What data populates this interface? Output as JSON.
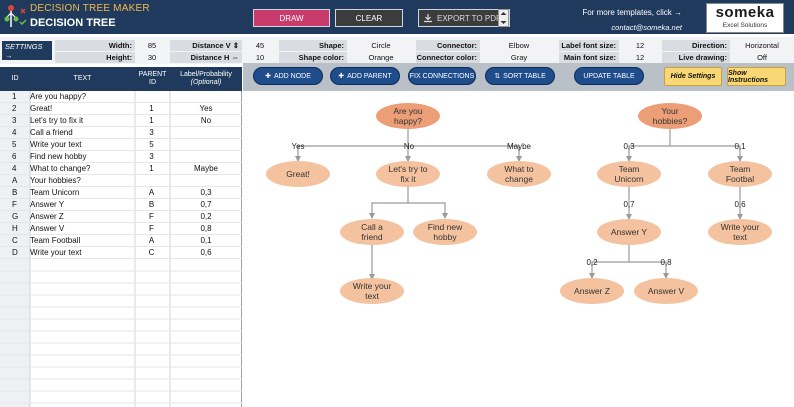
{
  "header": {
    "app_title": "DECISION TREE MAKER",
    "doc_title": "DECISION TREE",
    "draw_label": "DRAW",
    "clear_label": "CLEAR",
    "export_label": "EXPORT TO PDF",
    "templates_text": "For more templates, click →",
    "contact": "contact@someka.net",
    "brand_name": "someka",
    "brand_sub": "Excel Solutions"
  },
  "settings": {
    "label": "SETTINGS →",
    "width_label": "Width:",
    "width": "85",
    "height_label": "Height:",
    "height": "30",
    "distv_label": "Distance V ⇕",
    "distv": "45",
    "disth_label": "Distance H ⇔",
    "disth": "10",
    "shape_label": "Shape:",
    "shape": "Circle",
    "shape_color_label": "Shape color:",
    "shape_color": "Orange",
    "connector_label": "Connector:",
    "connector": "Elbow",
    "connector_color_label": "Connector color:",
    "connector_color": "Gray",
    "label_font_label": "Label font size:",
    "label_font": "12",
    "main_font_label": "Main font size:",
    "main_font": "12",
    "direction_label": "Direction:",
    "direction": "Horizontal",
    "live_label": "Live drawing:",
    "live": "Off"
  },
  "table": {
    "headers": {
      "id": "ID",
      "text": "TEXT",
      "parent1": "PARENT",
      "parent2": "ID",
      "label1": "Label/Probability",
      "label2": "(Optional)"
    },
    "rows": [
      {
        "id": "1",
        "text": "Are you happy?",
        "parent": "",
        "label": ""
      },
      {
        "id": "2",
        "text": "Great!",
        "parent": "1",
        "label": "Yes"
      },
      {
        "id": "3",
        "text": "Let's try to fix it",
        "parent": "1",
        "label": "No"
      },
      {
        "id": "4",
        "text": "Call a friend",
        "parent": "3",
        "label": ""
      },
      {
        "id": "5",
        "text": "Write your text",
        "parent": "5",
        "label": ""
      },
      {
        "id": "6",
        "text": "Find new hobby",
        "parent": "3",
        "label": ""
      },
      {
        "id": "4",
        "text": "What to change?",
        "parent": "1",
        "label": "Maybe"
      },
      {
        "id": "A",
        "text": "Your hobbies?",
        "parent": "",
        "label": ""
      },
      {
        "id": "B",
        "text": "Team Unicorn",
        "parent": "A",
        "label": "0,3"
      },
      {
        "id": "F",
        "text": "Answer Y",
        "parent": "B",
        "label": "0,7"
      },
      {
        "id": "G",
        "text": "Answer Z",
        "parent": "F",
        "label": "0,2"
      },
      {
        "id": "H",
        "text": "Answer V",
        "parent": "F",
        "label": "0,8"
      },
      {
        "id": "C",
        "text": "Team Football",
        "parent": "A",
        "label": "0,1"
      },
      {
        "id": "D",
        "text": "Write your text",
        "parent": "C",
        "label": "0,6"
      }
    ]
  },
  "actions": {
    "add_node": "ADD NODE",
    "add_parent": "ADD PARENT",
    "fix_connections": "FIX CONNECTIONS",
    "sort_table": "SORT TABLE",
    "update_table": "UPDATE TABLE",
    "hide_settings": "Hide Settings",
    "show_instructions": "Show Instructions"
  },
  "diagram": {
    "node_color": "#f4c29f",
    "root_color": "#ec9e76",
    "connector_color": "#9a9a9a",
    "nodes": {
      "n1": [
        "Are you",
        "happy?"
      ],
      "n2": [
        "Great!"
      ],
      "n3": [
        "Let's try to",
        "fix it"
      ],
      "n4": [
        "What to",
        "change"
      ],
      "n5": [
        "Call a",
        "friend"
      ],
      "n6": [
        "Find new",
        "hobby"
      ],
      "n7": [
        "Write your",
        "text"
      ],
      "nA": [
        "Your",
        "hobbies?"
      ],
      "nB": [
        "Team",
        "Unicorn"
      ],
      "nC": [
        "Team",
        "Footbal"
      ],
      "nF": [
        "Answer Y"
      ],
      "nD": [
        "Write your",
        "text"
      ],
      "nG": [
        "Answer Z"
      ],
      "nH": [
        "Answer V"
      ]
    },
    "edge_labels": {
      "yes": "Yes",
      "no": "No",
      "maybe": "Maybe",
      "p03": "0,3",
      "p01": "0,1",
      "p07": "0,7",
      "p06": "0,6",
      "p02": "0,2",
      "p08": "0,8"
    }
  }
}
